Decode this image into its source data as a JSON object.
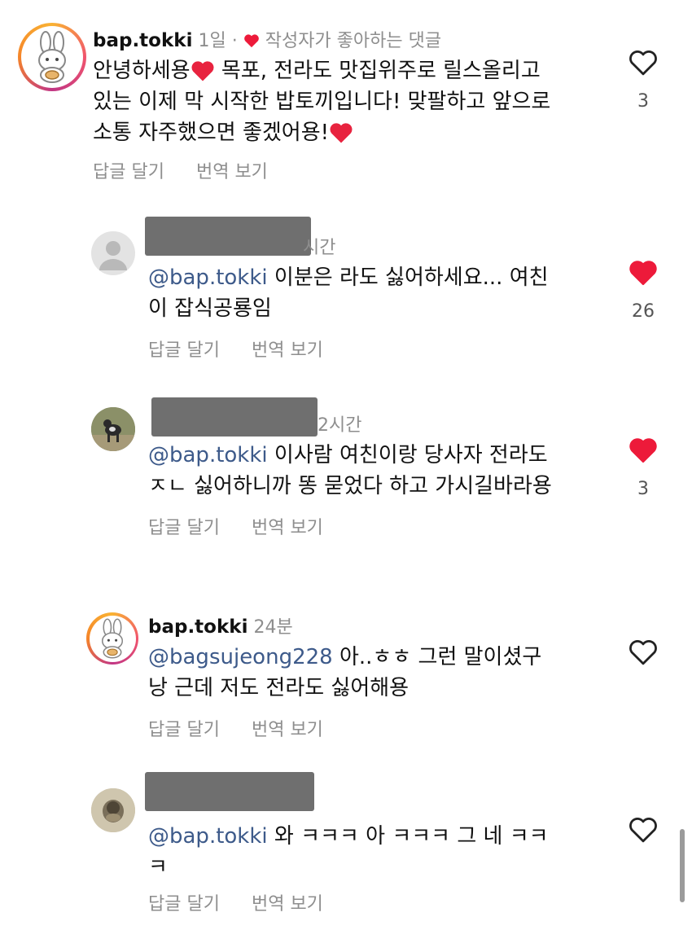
{
  "comments": [
    {
      "username": "bap.tokki",
      "time": "1일",
      "creator_liked_text": "작성자가 좋아하는 댓글",
      "lines": [
        "안녕하세용",
        "있는 이제 막 시작한 밥토끼입니다! 맞팔하고 앞으로",
        "소통 자주했으면 좋겠어용!"
      ],
      "line1_rest": " 목포, 전라도 맛집위주로 릴스올리고",
      "likes": "3",
      "reply_label": "답글 달기",
      "translate_label": "번역 보기"
    },
    {
      "time": "시간",
      "mention": "@bap.tokki",
      "lines": [
        " 이분은 라도 싫어하세요... 여친",
        "이 잡식공룡임"
      ],
      "likes": "26",
      "reply_label": "답글 달기",
      "translate_label": "번역 보기"
    },
    {
      "time": "2시간",
      "mention": "@bap.tokki",
      "lines": [
        " 이사람 여친이랑 당사자 전라도",
        "ㅈㄴ 싫어하니까 똥 묻었다 하고 가시길바라용"
      ],
      "likes": "3",
      "reply_label": "답글 달기",
      "translate_label": "번역 보기"
    },
    {
      "username": "bap.tokki",
      "time": "24분",
      "mention": "@bagsujeong228",
      "lines": [
        " 아..ㅎㅎ 그런 말이셨구",
        "낭 근데 저도 전라도 싫어해용"
      ],
      "reply_label": "답글 달기",
      "translate_label": "번역 보기"
    },
    {
      "mention": "@bap.tokki",
      "lines": [
        " 와 ㅋㅋㅋ 아 ㅋㅋㅋ 그 네 ㅋㅋ",
        "ㅋ"
      ],
      "reply_label": "답글 달기",
      "translate_label": "번역 보기"
    }
  ],
  "colors": {
    "mention": "#3d5a8a",
    "heart_red": "#ed1a3a",
    "meta_gray": "#8e8e8e"
  }
}
